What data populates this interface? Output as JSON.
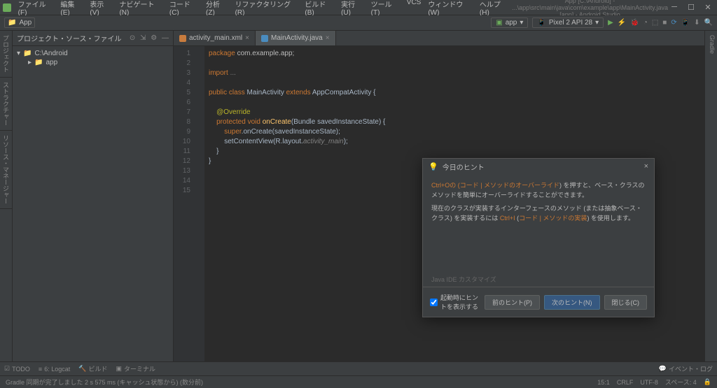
{
  "menu": {
    "file": "ファイル(F)",
    "edit": "編集(E)",
    "view": "表示(V)",
    "navigate": "ナビゲート(N)",
    "code": "コード(C)",
    "analyze": "分析(Z)",
    "refactor": "リファクタリング(R)",
    "build": "ビルド(B)",
    "run": "実行(U)",
    "tools": "ツール(T)",
    "vcs": "VCS",
    "window": "ウィンドウ(W)",
    "help": "ヘルプ(H)"
  },
  "window_title": "App [C:\\Android] - ...\\app\\src\\main\\java\\com\\example\\app\\MainActivity.java [app] - Android Studio",
  "toolbar": {
    "project_label": "App",
    "run_config": "app",
    "device": "Pixel 2 API 28"
  },
  "sidebar": {
    "title": "プロジェクト・ソース・ファイル",
    "root": "C:\\Android",
    "child": "app"
  },
  "left_tabs": {
    "project": "プロジェクト",
    "structure": "ストラクチャー",
    "resources": "リソース・マネージャー"
  },
  "right_tabs": {
    "gradle": "Gradle"
  },
  "editor_tabs": {
    "xml": "activity_main.xml",
    "java": "MainActivity.java"
  },
  "code": {
    "line1_a": "package",
    "line1_b": " com.example.app;",
    "line3_a": "import",
    "line3_b": " ...",
    "line5_a": "public class",
    "line5_b": " MainActivity ",
    "line5_c": "extends",
    "line5_d": " AppCompatActivity {",
    "line7": "    @Override",
    "line8_a": "    protected void",
    "line8_b": " onCreate",
    "line8_c": "(Bundle savedInstanceState) {",
    "line9_a": "        super",
    "line9_b": ".onCreate(savedInstanceState);",
    "line10_a": "        setContentView(R.layout.",
    "line10_b": "activity_main",
    "line10_c": ");",
    "line11": "    }",
    "line12": "}"
  },
  "gutter": [
    "1",
    "2",
    "3",
    "4",
    "5",
    "6",
    "7",
    "8",
    "9",
    "10",
    "11",
    "12",
    "13",
    "14",
    "15"
  ],
  "dialog": {
    "title": "今日のヒント",
    "body1_a": "Ctrl+Oの (",
    "body1_hl": "コード | メソッドのオーバーライド",
    "body1_b": ") を押すと、ベース・クラスのメソッドを簡単にオーバーライドすることができます。",
    "body2_a": "現在のクラスが実装するインターフェースのメソッド (または抽象ベース・クラス) を実装するには ",
    "body2_hl": "Ctrl+I",
    "body2_b": " (",
    "body2_hl2": "コード | メソッドの実装",
    "body2_c": ") を使用します。",
    "link": "Java IDE カスタマイズ",
    "checkbox": "起動時にヒントを表示する",
    "prev": "前のヒント(P)",
    "next": "次のヒント(N)",
    "close": "閉じる(C)"
  },
  "bottom": {
    "todo": "TODO",
    "logcat": "6: Logcat",
    "build": "ビルド",
    "terminal": "ターミナル",
    "event_log": "イベント・ログ"
  },
  "status": {
    "msg": "Gradle 同期が完了しました 2 s 575 ms (キャッシュ状態から) (数分前)",
    "pos": "15:1",
    "encoding": "CRLF",
    "charset": "UTF-8",
    "indent": "スペース: 4"
  }
}
